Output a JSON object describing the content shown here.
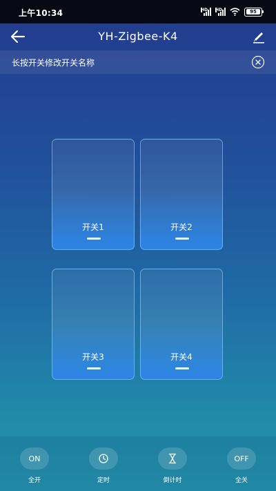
{
  "statusbar": {
    "time": "上午10:34",
    "battery": "95"
  },
  "header": {
    "title": "YH-Zigbee-K4"
  },
  "notice": {
    "text": "长按开关修改开关名称"
  },
  "switches": [
    {
      "label": "开关1"
    },
    {
      "label": "开关2"
    },
    {
      "label": "开关3"
    },
    {
      "label": "开关4"
    }
  ],
  "bottom": {
    "all_on": {
      "icon_text": "ON",
      "label": "全开"
    },
    "timer": {
      "icon": "clock-icon",
      "label": "定时"
    },
    "countdown": {
      "icon": "hourglass-icon",
      "label": "倒计时"
    },
    "all_off": {
      "icon_text": "OFF",
      "label": "全关"
    }
  }
}
